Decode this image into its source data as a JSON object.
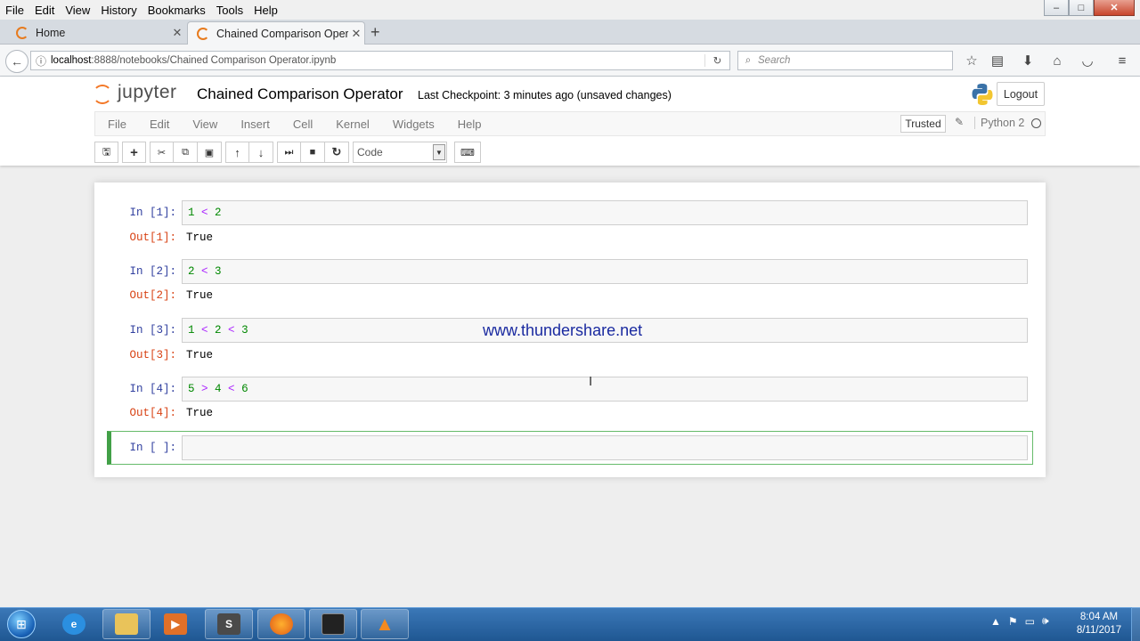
{
  "browser": {
    "menu": [
      "File",
      "Edit",
      "View",
      "History",
      "Bookmarks",
      "Tools",
      "Help"
    ],
    "window_controls": {
      "minimize": "–",
      "maximize": "□",
      "close": "✕"
    },
    "tabs": [
      {
        "label": "Home",
        "close": "✕"
      },
      {
        "label": "Chained Comparison Operat",
        "close": "✕"
      }
    ],
    "new_tab": "+",
    "url": {
      "host": "localhost",
      "rest": ":8888/notebooks/Chained Comparison Operator.ipynb"
    },
    "search_placeholder": "Search"
  },
  "jupyter": {
    "logo_text": "jupyter",
    "notebook_title": "Chained Comparison Operator",
    "checkpoint": "Last Checkpoint: 3 minutes ago (unsaved changes)",
    "logout_label": "Logout",
    "menu": [
      "File",
      "Edit",
      "View",
      "Insert",
      "Cell",
      "Kernel",
      "Widgets",
      "Help"
    ],
    "trusted_label": "Trusted",
    "kernel_name": "Python 2",
    "cell_type": "Code",
    "toolbar_icons": [
      "save-icon",
      "add-cell-icon",
      "cut-icon",
      "copy-icon",
      "paste-icon",
      "move-up-icon",
      "move-down-icon",
      "run-icon",
      "stop-icon",
      "restart-icon",
      "keyboard-icon"
    ]
  },
  "cells": [
    {
      "in": "In [1]:",
      "code": [
        "1",
        " < ",
        "2"
      ],
      "out_prompt": "Out[1]:",
      "out": "True"
    },
    {
      "in": "In [2]:",
      "code": [
        "2",
        " < ",
        "3"
      ],
      "out_prompt": "Out[2]:",
      "out": "True"
    },
    {
      "in": "In [3]:",
      "code": [
        "1",
        " < ",
        "2",
        " < ",
        "3"
      ],
      "out_prompt": "Out[3]:",
      "out": "True"
    },
    {
      "in": "In [4]:",
      "code": [
        "5",
        " > ",
        "4",
        " < ",
        "6"
      ],
      "out_prompt": "Out[4]:",
      "out": "True"
    }
  ],
  "empty_cell_prompt": "In [ ]:",
  "watermark": "www.thundershare.net",
  "taskbar": {
    "apps": [
      "start-orb",
      "internet-explorer-icon",
      "file-explorer-icon",
      "media-player-icon",
      "sublime-text-icon",
      "firefox-icon",
      "command-prompt-icon",
      "vlc-icon"
    ],
    "clock_time": "8:04 AM",
    "clock_date": "8/11/2017"
  },
  "colors": {
    "prompt_in": "#303f9f",
    "prompt_out": "#d84315",
    "number": "#008800",
    "operator": "#aa22ff",
    "selected_border": "#42a047"
  }
}
